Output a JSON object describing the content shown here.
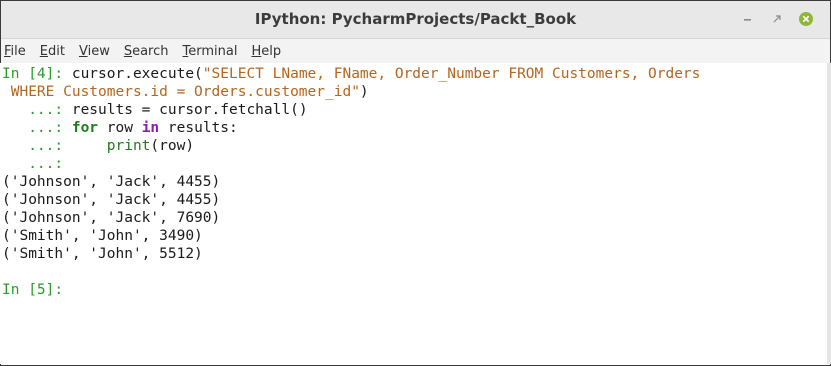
{
  "window": {
    "title": "IPython: PycharmProjects/Packt_Book",
    "accent_close": "#8fb83a"
  },
  "menubar": {
    "items": [
      {
        "acc": "F",
        "rest": "ile"
      },
      {
        "acc": "E",
        "rest": "dit"
      },
      {
        "acc": "V",
        "rest": "iew"
      },
      {
        "acc": "S",
        "rest": "earch"
      },
      {
        "acc": "T",
        "rest": "erminal"
      },
      {
        "acc": "H",
        "rest": "elp"
      }
    ]
  },
  "terminal": {
    "prompt_in4": "In [4]: ",
    "code_call": "cursor.execute(",
    "sql_line1": "\"SELECT LName, FName, Order_Number FROM Customers, Orders",
    "sql_line2": " WHERE Customers.id = Orders.customer_id\"",
    "code_close": ")",
    "cont": "   ...: ",
    "cont_last": "   ...:",
    "line_results": "results = cursor.fetchall()",
    "kw_for": "for",
    "row_text": " row ",
    "kw_in": "in",
    "results_colon": " results:",
    "indent": "    ",
    "fn_print": "print",
    "print_args": "(row)",
    "outputs": [
      "('Johnson', 'Jack', 4455)",
      "('Johnson', 'Jack', 4455)",
      "('Johnson', 'Jack', 7690)",
      "('Smith', 'John', 3490)",
      "('Smith', 'John', 5512)"
    ],
    "prompt_in5": "In [5]:"
  }
}
